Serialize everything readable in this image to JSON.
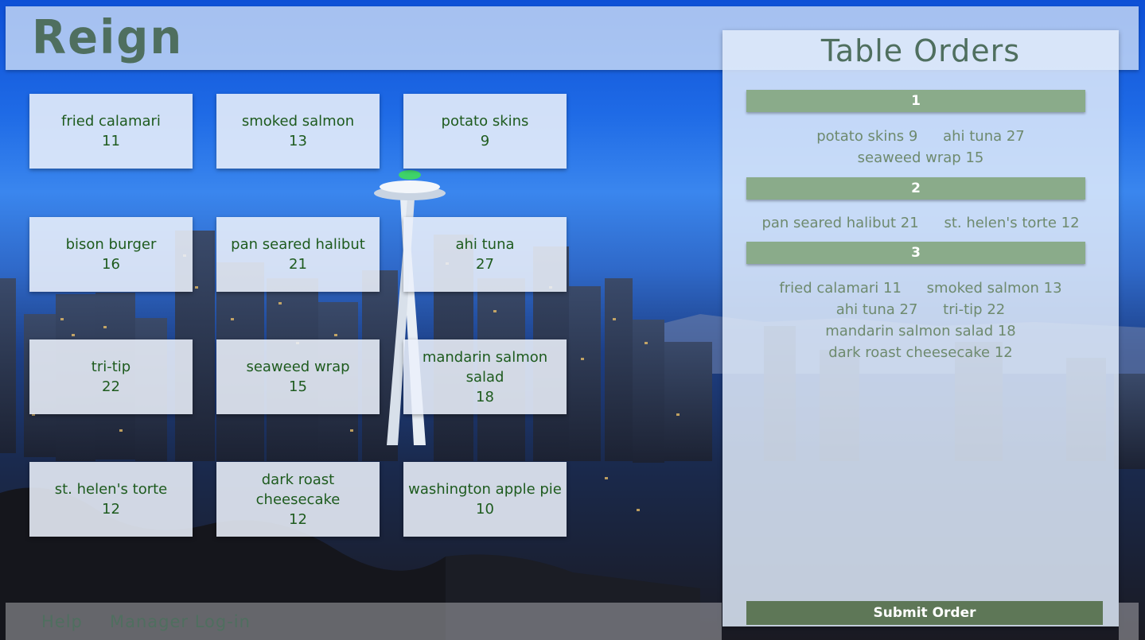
{
  "app": {
    "brand": "Reign"
  },
  "menu": {
    "items": [
      {
        "name": "fried calamari",
        "price": "11"
      },
      {
        "name": "smoked salmon",
        "price": "13"
      },
      {
        "name": "potato skins",
        "price": "9"
      },
      {
        "name": "bison burger",
        "price": "16"
      },
      {
        "name": "pan seared halibut",
        "price": "21"
      },
      {
        "name": "ahi tuna",
        "price": "27"
      },
      {
        "name": "tri-tip",
        "price": "22"
      },
      {
        "name": "seaweed wrap",
        "price": "15"
      },
      {
        "name": "mandarin salmon salad",
        "price": "18"
      },
      {
        "name": "st. helen's torte",
        "price": "12"
      },
      {
        "name": "dark roast cheesecake",
        "price": "12"
      },
      {
        "name": "washington apple pie",
        "price": "10"
      }
    ]
  },
  "orders": {
    "title": "Table Orders",
    "tables": [
      {
        "label": "1",
        "lines": [
          [
            "potato skins 9",
            "ahi tuna 27"
          ],
          [
            "seaweed wrap 15"
          ]
        ]
      },
      {
        "label": "2",
        "lines": [
          [
            "pan seared halibut 21",
            "st. helen's torte 12"
          ]
        ]
      },
      {
        "label": "3",
        "lines": [
          [
            "fried calamari 11",
            "smoked salmon 13"
          ],
          [
            "ahi tuna 27",
            "tri-tip 22"
          ],
          [
            "mandarin salmon salad 18"
          ],
          [
            "dark roast cheesecake 12"
          ]
        ]
      }
    ],
    "submit_label": "Submit Order"
  },
  "footer": {
    "help_label": "Help",
    "manager_label": "Manager Log-in"
  },
  "colors": {
    "accent": "#8aab8a",
    "submit": "#5e7757",
    "text_green": "#1e5b1e",
    "brand": "#4f6f5f"
  }
}
